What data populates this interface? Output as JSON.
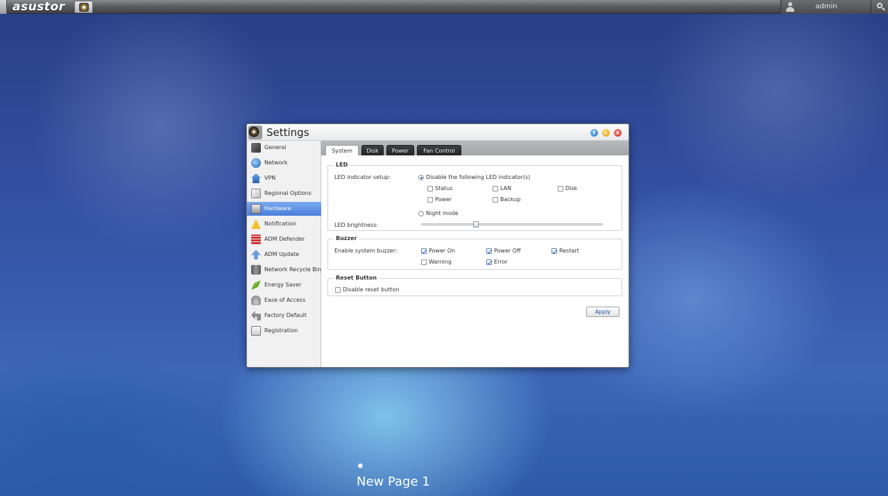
{
  "topbar": {
    "logo": "asustor",
    "user": "admin"
  },
  "window": {
    "title": "Settings",
    "buttons": {
      "help": "?",
      "minimize": "–",
      "close": "×"
    }
  },
  "sidebar": {
    "items": [
      {
        "label": "General",
        "icon": "server-icon"
      },
      {
        "label": "Network",
        "icon": "globe-icon"
      },
      {
        "label": "VPN",
        "icon": "house-icon"
      },
      {
        "label": "Regional Options",
        "icon": "clock-icon"
      },
      {
        "label": "Hardware",
        "icon": "hardware-icon",
        "active": true
      },
      {
        "label": "Notification",
        "icon": "warning-icon"
      },
      {
        "label": "ADM Defender",
        "icon": "firewall-icon"
      },
      {
        "label": "ADM Update",
        "icon": "up-arrow-icon"
      },
      {
        "label": "Network Recycle Bin",
        "icon": "trash-icon"
      },
      {
        "label": "Energy Saver",
        "icon": "leaf-icon"
      },
      {
        "label": "Ease of Access",
        "icon": "router-icon"
      },
      {
        "label": "Factory Default",
        "icon": "undo-arrow-icon"
      },
      {
        "label": "Registration",
        "icon": "clipboard-icon"
      }
    ]
  },
  "tabs": [
    {
      "label": "System",
      "active": true
    },
    {
      "label": "Disk"
    },
    {
      "label": "Power"
    },
    {
      "label": "Fan Control"
    }
  ],
  "led": {
    "title": "LED",
    "setup_label": "LED indicator setup:",
    "disable_option": "Disable the following LED indicator(s)",
    "checkboxes": [
      {
        "label": "Status",
        "checked": false
      },
      {
        "label": "LAN",
        "checked": false
      },
      {
        "label": "Disk",
        "checked": false
      },
      {
        "label": "Power",
        "checked": false
      },
      {
        "label": "Backup",
        "checked": false
      }
    ],
    "night_mode": "Night mode",
    "brightness_label": "LED brightness:",
    "brightness_value": 0.3
  },
  "buzzer": {
    "title": "Buzzer",
    "label": "Enable system buzzer:",
    "checkboxes": [
      {
        "label": "Power On",
        "checked": true
      },
      {
        "label": "Power Off",
        "checked": true
      },
      {
        "label": "Restart",
        "checked": true
      },
      {
        "label": "Warning",
        "checked": false
      },
      {
        "label": "Error",
        "checked": true
      }
    ]
  },
  "reset": {
    "title": "Reset Button",
    "checkbox_label": "Disable reset button",
    "checked": false
  },
  "apply_label": "Apply",
  "desktop": {
    "page_label": "New Page 1"
  }
}
